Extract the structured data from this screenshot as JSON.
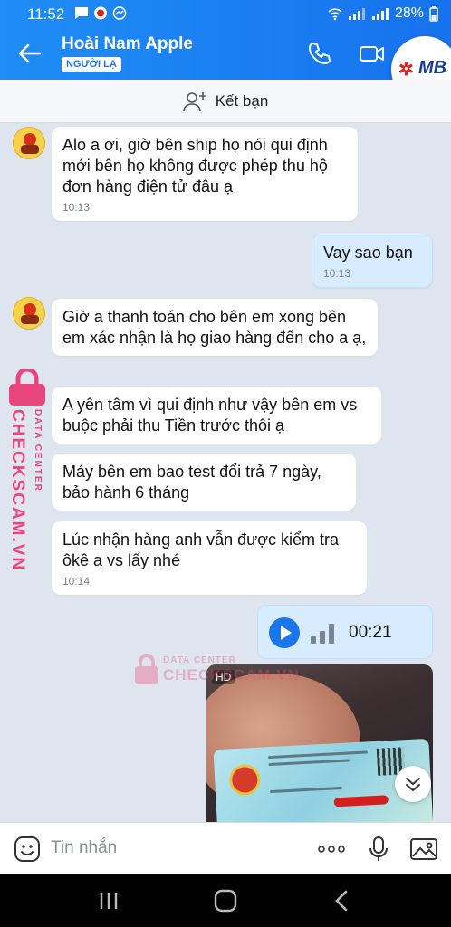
{
  "status_bar": {
    "time": "11:52",
    "battery": "28%"
  },
  "header": {
    "contact_name": "Hoài Nam Apple",
    "stranger_badge": "NGƯỜI LẠ"
  },
  "overlay_logo": {
    "text": "MB"
  },
  "add_friend": {
    "label": "Kết bạn"
  },
  "messages": [
    {
      "sender": "other",
      "text": "Alo a ơi,  giờ bên ship họ nói qui định mới bên họ không được phép thu hộ đơn hàng điện tử đâu ạ",
      "time": "10:13"
    },
    {
      "sender": "me",
      "text": "Vay sao bạn",
      "time": "10:13"
    },
    {
      "sender": "other",
      "text": "Giờ a thanh toán cho bên em xong bên em xác nhận là họ giao hàng đến cho a ạ,"
    },
    {
      "sender": "other",
      "text": "A yên tâm vì qui định như vậy bên em vs buộc phải thu Tiền trước thôi ạ"
    },
    {
      "sender": "other",
      "text": "Máy bên em bao test đổi trả 7 ngày, bảo hành 6 tháng"
    },
    {
      "sender": "other",
      "text": "Lúc nhận hàng anh vẫn được kiểm tra ôkê a vs lấy nhé",
      "time": "10:14"
    }
  ],
  "voice_message": {
    "duration": "00:21"
  },
  "photo_message": {
    "badge": "HD"
  },
  "composer": {
    "placeholder": "Tin nhắn"
  },
  "watermark": {
    "line1": "DATA CENTER",
    "line2": "CHECKSCAM.VN"
  },
  "colors": {
    "header_blue": "#1a76ea",
    "my_bubble": "#d7ecff",
    "background": "#dfe5ee",
    "watermark_pink": "#e8467c"
  }
}
